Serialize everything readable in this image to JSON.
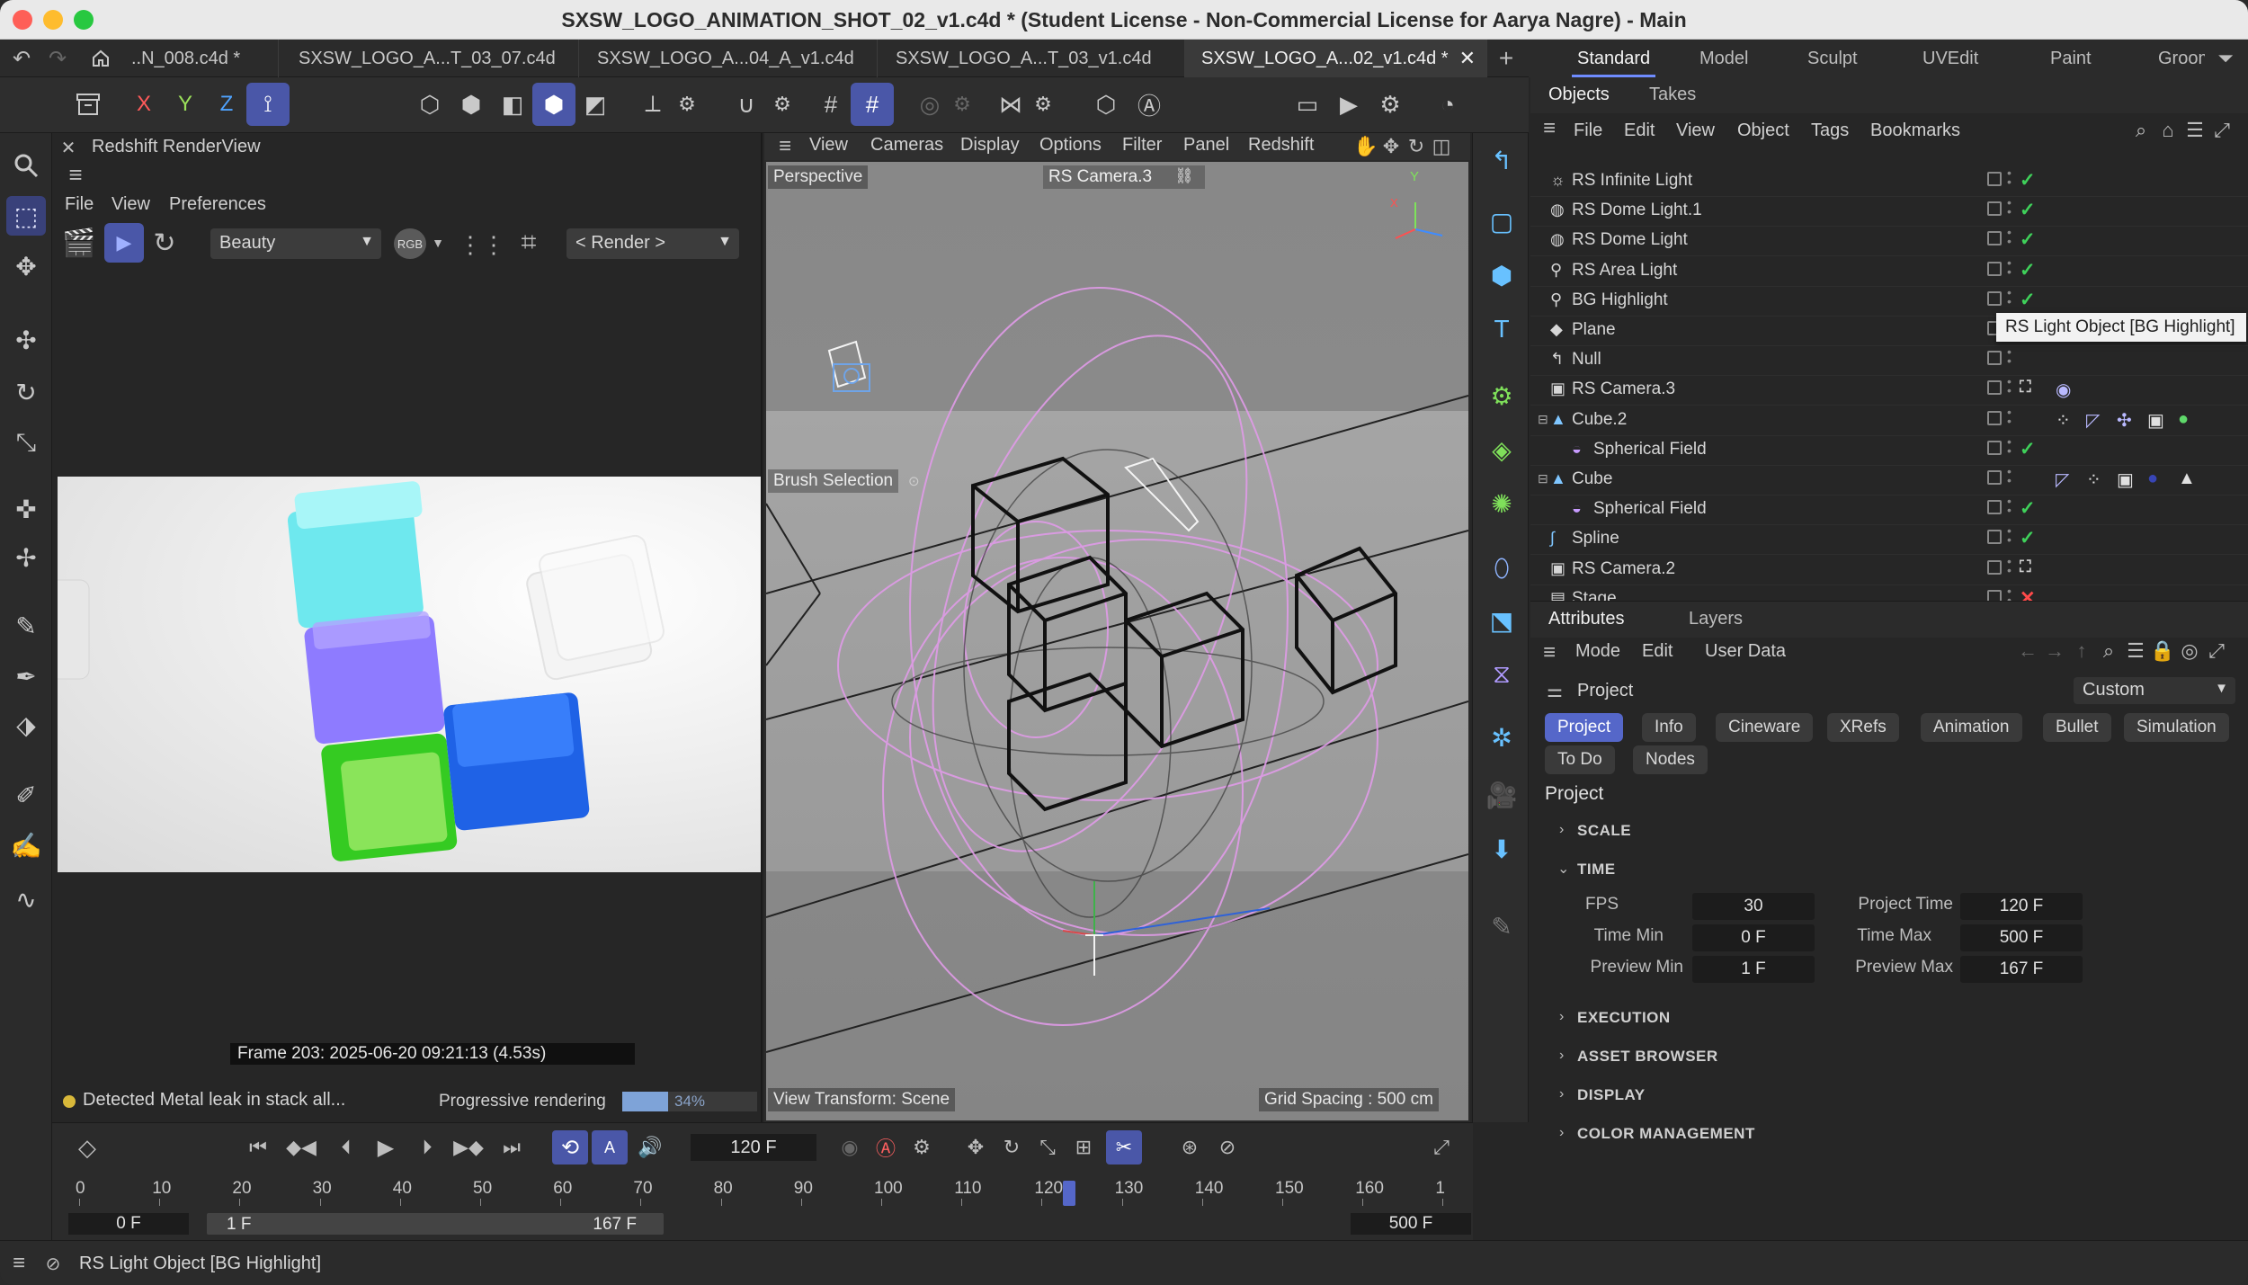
{
  "window": {
    "title": "SXSW_LOGO_ANIMATION_SHOT_02_v1.c4d * (Student License - Non-Commercial License for Aarya Nagre) - Main"
  },
  "doc_tabs": [
    {
      "label": "..N_008.c4d *"
    },
    {
      "label": "SXSW_LOGO_A...T_03_07.c4d"
    },
    {
      "label": "SXSW_LOGO_A...04_A_v1.c4d"
    },
    {
      "label": "SXSW_LOGO_A...T_03_v1.c4d"
    },
    {
      "label": "SXSW_LOGO_A...02_v1.c4d *"
    }
  ],
  "layouts": [
    "Standard",
    "Model",
    "Sculpt",
    "UVEdit",
    "Paint",
    "Groom"
  ],
  "axis_labels": {
    "x": "X",
    "y": "Y",
    "z": "Z"
  },
  "renderview": {
    "title": "Redshift RenderView",
    "menu": [
      "File",
      "View",
      "Preferences"
    ],
    "aov": "Beauty",
    "rgb": "RGB",
    "render": "< Render >",
    "frame_info": "Frame  203:  2025-06-20  09:21:13  (4.53s)",
    "warning": "Detected Metal leak in stack all...",
    "progress_label": "Progressive rendering",
    "progress_value": "34%",
    "progress_fraction": 0.34
  },
  "viewport": {
    "menu": [
      "View",
      "Cameras",
      "Display",
      "Options",
      "Filter",
      "Panel",
      "Redshift"
    ],
    "name": "Perspective",
    "camera": "RS Camera.3",
    "brush": "Brush Selection",
    "view_transform": "View Transform: Scene",
    "grid": "Grid Spacing : 500 cm",
    "axis_y": "Y",
    "axis_x": "X"
  },
  "objects": {
    "tabs": [
      "Objects",
      "Takes"
    ],
    "menu": [
      "File",
      "Edit",
      "View",
      "Object",
      "Tags",
      "Bookmarks"
    ],
    "rows": [
      {
        "name": "RS Infinite Light",
        "icon": "sun-light-icon",
        "status": "check"
      },
      {
        "name": "RS Dome Light.1",
        "icon": "globe-light-icon",
        "status": "check"
      },
      {
        "name": "RS Dome Light",
        "icon": "globe-light-icon",
        "status": "check"
      },
      {
        "name": "RS Area Light",
        "icon": "area-light-icon",
        "status": "check"
      },
      {
        "name": "BG Highlight",
        "icon": "area-light-icon",
        "status": "check"
      },
      {
        "name": "Plane",
        "icon": "plane-icon",
        "status": "check"
      },
      {
        "name": "Null",
        "icon": "null-icon",
        "status": "none"
      },
      {
        "name": "RS Camera.3",
        "icon": "camera-icon",
        "status": "cam"
      },
      {
        "name": "Cube.2",
        "icon": "cube-icon",
        "status": "none"
      },
      {
        "name": "Spherical Field",
        "icon": "field-icon",
        "status": "check"
      },
      {
        "name": "Cube",
        "icon": "cube-icon",
        "status": "none"
      },
      {
        "name": "Spherical Field",
        "icon": "field-icon",
        "status": "check"
      },
      {
        "name": "Spline",
        "icon": "spline-icon",
        "status": "check"
      },
      {
        "name": "RS Camera.2",
        "icon": "camera-icon",
        "status": "cam"
      },
      {
        "name": "Stage",
        "icon": "stage-icon",
        "status": "cross"
      }
    ],
    "tooltip": "RS Light Object [BG Highlight]"
  },
  "attributes": {
    "tabs": [
      "Attributes",
      "Layers"
    ],
    "menu": [
      "Mode",
      "Edit",
      "User Data"
    ],
    "object": "Project",
    "preset": "Custom",
    "pills_row1": [
      "Project",
      "Info",
      "Cineware",
      "XRefs",
      "Animation",
      "Bullet",
      "Simulation"
    ],
    "pills_row2": [
      "To Do",
      "Nodes"
    ],
    "heading": "Project",
    "sections": [
      "SCALE",
      "TIME",
      "EXECUTION",
      "ASSET BROWSER",
      "DISPLAY",
      "COLOR MANAGEMENT"
    ],
    "fields": {
      "fps_label": "FPS",
      "fps": "30",
      "time_min_label": "Time Min",
      "time_min": "0 F",
      "preview_min_label": "Preview Min",
      "preview_min": "1 F",
      "project_time_label": "Project Time",
      "project_time": "120 F",
      "time_max_label": "Time Max",
      "time_max": "500 F",
      "preview_max_label": "Preview Max",
      "preview_max": "167 F"
    }
  },
  "timeline": {
    "current_frame": "120 F",
    "ticks": [
      "0",
      "10",
      "20",
      "30",
      "40",
      "50",
      "60",
      "70",
      "80",
      "90",
      "100",
      "110",
      "120",
      "130",
      "140",
      "150",
      "160",
      "1"
    ],
    "start": "0 F",
    "preview_start": "1 F",
    "preview_end": "167 F",
    "end": "500 F"
  },
  "statusbar": {
    "text": "RS Light Object [BG Highlight]"
  }
}
